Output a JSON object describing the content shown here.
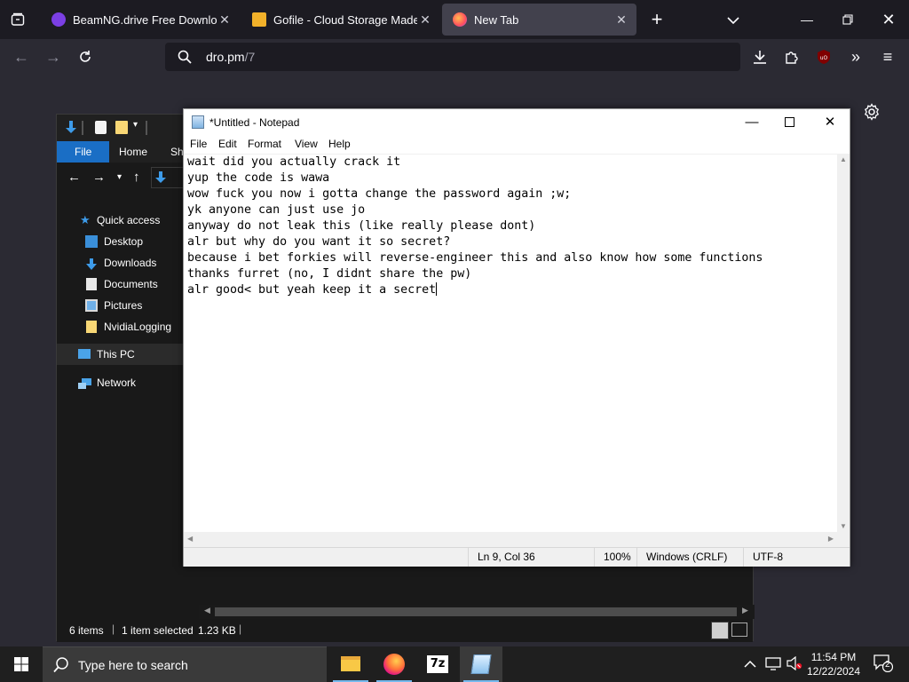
{
  "browser": {
    "tabs": [
      {
        "title": "BeamNG.drive Free Download (",
        "active": false
      },
      {
        "title": "Gofile - Cloud Storage Made Si",
        "active": false
      },
      {
        "title": "New Tab",
        "active": true
      }
    ],
    "url_host": "dro.pm",
    "url_path": "/7"
  },
  "explorer": {
    "ribbon_tabs": [
      "File",
      "Home",
      "Sh"
    ],
    "nav_items": [
      "Quick access",
      "Desktop",
      "Downloads",
      "Documents",
      "Pictures",
      "NvidiaLogging",
      "This PC",
      "Network"
    ],
    "status": {
      "items": "6 items",
      "selected": "1 item selected",
      "size": "1.23 KB"
    }
  },
  "notepad": {
    "title": "*Untitled - Notepad",
    "menu": [
      "File",
      "Edit",
      "Format",
      "View",
      "Help"
    ],
    "lines": [
      "wait did you actually crack it",
      "yup the code is wawa",
      "wow fuck you now i gotta change the password again ;w;",
      "yk anyone can just use jo",
      "anyway do not leak this (like really please dont)",
      "alr but why do you want it so secret?",
      "because i bet forkies will reverse-engineer this and also know how some functions",
      "thanks furret (no, I didnt share the pw)",
      "alr good< but yeah keep it a secret"
    ],
    "status": {
      "position": "Ln 9, Col 36",
      "zoom": "100%",
      "line_ending": "Windows (CRLF)",
      "encoding": "UTF-8"
    }
  },
  "taskbar": {
    "search_placeholder": "Type here to search",
    "apps": [
      "file-explorer",
      "firefox",
      "7-zip",
      "notepad"
    ],
    "time": "11:54 PM",
    "date": "12/22/2024",
    "notification_count": "2"
  }
}
